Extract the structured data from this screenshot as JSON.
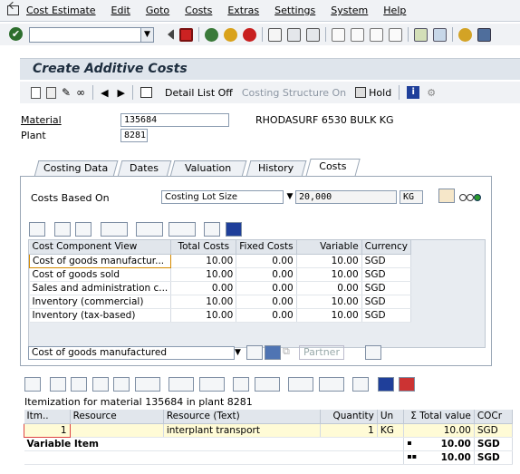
{
  "menu": [
    "Cost Estimate",
    "Edit",
    "Goto",
    "Costs",
    "Extras",
    "Settings",
    "System",
    "Help"
  ],
  "page_title": "Create Additive Costs",
  "app_toolbar": {
    "detail_list_off": "Detail List Off",
    "costing_structure_on": "Costing Structure On",
    "hold": "Hold"
  },
  "header": {
    "material_label": "Material",
    "material_value": "135684",
    "material_desc": "RHODASURF 6530 BULK KG",
    "plant_label": "Plant",
    "plant_value": "8281"
  },
  "tabs": [
    "Costing Data",
    "Dates",
    "Valuation",
    "History",
    "Costs"
  ],
  "costs": {
    "based_on_label": "Costs Based On",
    "based_on_value": "Costing Lot Size",
    "lot_size": "20,000",
    "unit": "KG"
  },
  "grid": {
    "headers": [
      "Cost Component View",
      "Total Costs",
      "Fixed Costs",
      "Variable",
      "Currency"
    ],
    "rows": [
      [
        "Cost of goods manufactur...",
        "10.00",
        "0.00",
        "10.00",
        "SGD"
      ],
      [
        "Cost of goods sold",
        "10.00",
        "0.00",
        "10.00",
        "SGD"
      ],
      [
        "Sales and administration c...",
        "0.00",
        "0.00",
        "0.00",
        "SGD"
      ],
      [
        "Inventory (commercial)",
        "10.00",
        "0.00",
        "10.00",
        "SGD"
      ],
      [
        "Inventory (tax-based)",
        "10.00",
        "0.00",
        "10.00",
        "SGD"
      ]
    ]
  },
  "view_select": "Cost of goods manufactured",
  "partner_label": "Partner",
  "itemization": {
    "caption": "Itemization for material 135684 in plant 8281",
    "headers": [
      "Itm..",
      "Resource",
      "Resource (Text)",
      "Quantity",
      "Un",
      "Σ Total value",
      "COCr"
    ],
    "row": [
      "1",
      "",
      "interplant transport",
      "1",
      "KG",
      "10.00",
      "SGD"
    ],
    "total_label": "Variable Item",
    "total_value": "10.00",
    "total_currency": "SGD",
    "grand_value": "10.00",
    "grand_currency": "SGD"
  }
}
